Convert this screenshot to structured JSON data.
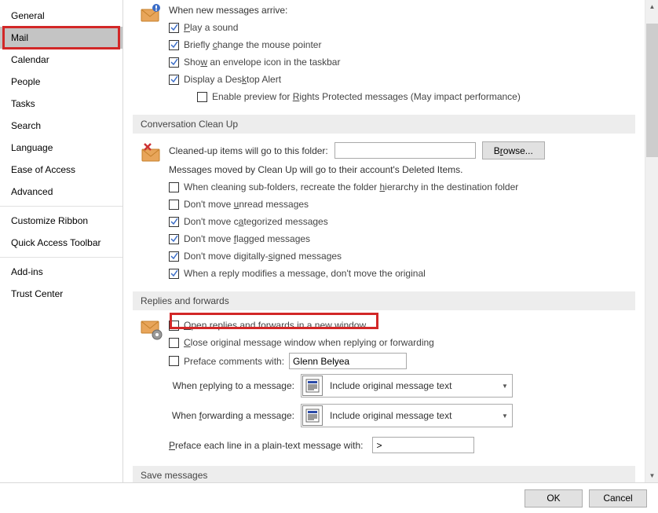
{
  "sidebar": {
    "items": [
      {
        "label": "General"
      },
      {
        "label": "Mail"
      },
      {
        "label": "Calendar"
      },
      {
        "label": "People"
      },
      {
        "label": "Tasks"
      },
      {
        "label": "Search"
      },
      {
        "label": "Language"
      },
      {
        "label": "Ease of Access"
      },
      {
        "label": "Advanced"
      }
    ],
    "items2": [
      {
        "label": "Customize Ribbon"
      },
      {
        "label": "Quick Access Toolbar"
      }
    ],
    "items3": [
      {
        "label": "Add-ins"
      },
      {
        "label": "Trust Center"
      }
    ],
    "selected": "Mail"
  },
  "arrival": {
    "heading": "When new messages arrive:",
    "play_sound": "Play a sound",
    "change_pointer_pre": "Briefly ",
    "change_pointer_u": "c",
    "change_pointer_post": "hange the mouse pointer",
    "show_envelope_pre": "Sho",
    "show_envelope_u": "w",
    "show_envelope_post": " an envelope icon in the taskbar",
    "desktop_alert_pre": "Display a Des",
    "desktop_alert_u": "k",
    "desktop_alert_post": "top Alert",
    "rights_pre": "Enable preview for ",
    "rights_u": "R",
    "rights_post": "ights Protected messages (May impact performance)"
  },
  "cleanup": {
    "header": "Conversation Clean Up",
    "folder_label": "Cleaned-up items will go to this folder:",
    "browse_pre": "B",
    "browse_u": "r",
    "browse_post": "owse...",
    "moved_note": "Messages moved by Clean Up will go to their account's Deleted Items.",
    "subfolders_pre": "When cleaning sub-folders, recreate the folder ",
    "subfolders_u": "h",
    "subfolders_post": "ierarchy in the destination folder",
    "unread_pre": "Don't move ",
    "unread_u": "u",
    "unread_post": "nread messages",
    "categorized_pre": "Don't move c",
    "categorized_u": "a",
    "categorized_post": "tegorized messages",
    "flagged_pre": "Don't move ",
    "flagged_u": "f",
    "flagged_post": "lagged messages",
    "signed_pre": "Don't move digitally-",
    "signed_u": "s",
    "signed_post": "igned messages",
    "reply_modifies": "When a reply modifies a message, don't move the original"
  },
  "replies": {
    "header": "Replies and forwards",
    "open_new_pre": "",
    "open_new_u": "O",
    "open_new_post": "pen replies and forwards in a new window",
    "close_orig_pre": "",
    "close_orig_u": "C",
    "close_orig_post": "lose original message window when replying or forwarding",
    "preface_label": "Preface comments with:",
    "preface_value": "Glenn Belyea",
    "when_reply_pre": "When ",
    "when_reply_u": "r",
    "when_reply_post": "eplying to a message:",
    "when_forward_pre": "When ",
    "when_forward_u": "f",
    "when_forward_post": "orwarding a message:",
    "include_original": "Include original message text",
    "preface_line_pre": "",
    "preface_line_u": "P",
    "preface_line_post": "reface each line in a plain-text message with:",
    "preface_char": ">"
  },
  "save": {
    "header": "Save messages"
  },
  "footer": {
    "ok": "OK",
    "cancel": "Cancel"
  }
}
